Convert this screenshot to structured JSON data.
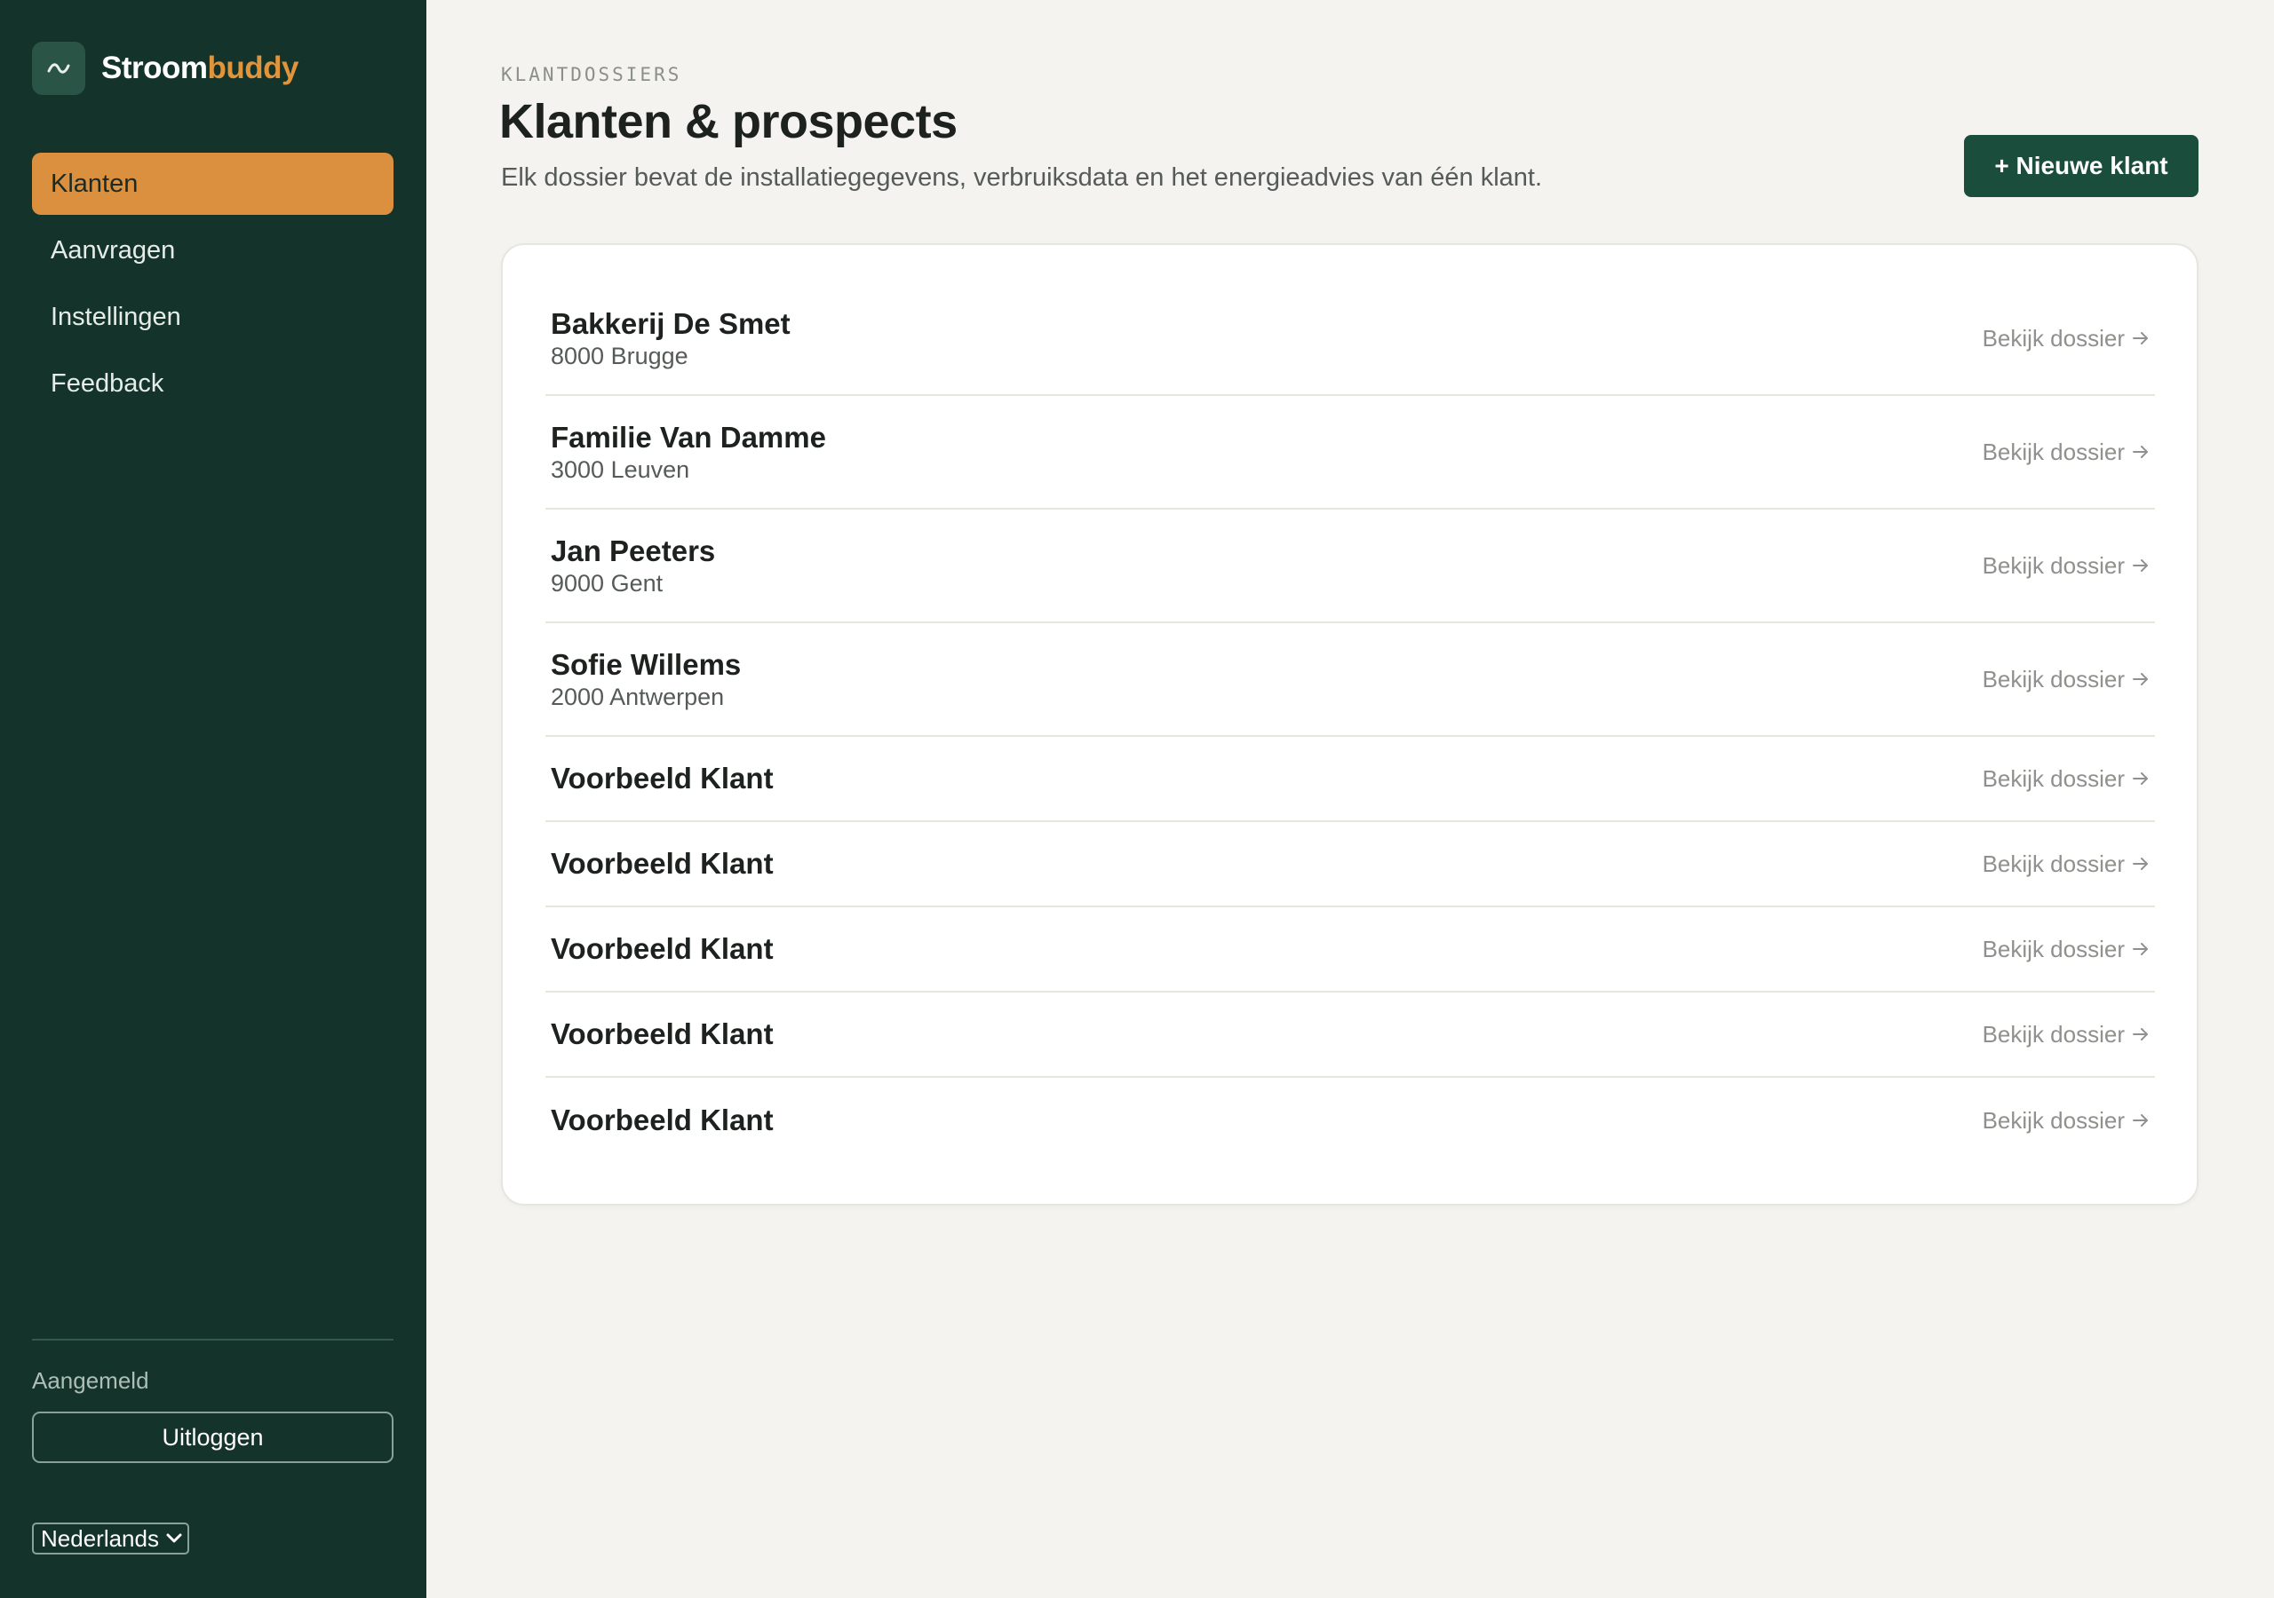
{
  "brand": {
    "name_part1": "Stroom",
    "name_part2": "buddy",
    "logo_icon": "wave-icon",
    "accent_color": "#e0953c"
  },
  "sidebar": {
    "items": [
      {
        "label": "Klanten",
        "active": true
      },
      {
        "label": "Aanvragen",
        "active": false
      },
      {
        "label": "Instellingen",
        "active": false
      },
      {
        "label": "Feedback",
        "active": false
      }
    ],
    "signed_in_label": "Aangemeld",
    "logout_label": "Uitloggen",
    "language": "Nederlands"
  },
  "header": {
    "eyebrow": "KLANTDOSSIERS",
    "title": "Klanten & prospects",
    "subtitle": "Elk dossier bevat de installatiegegevens, verbruiksdata en het energieadvies van één klant.",
    "new_client_label": "+ Nieuwe klant"
  },
  "clients": {
    "link_label": "Bekijk dossier",
    "rows": [
      {
        "name": "Bakkerij De Smet",
        "city": "8000 Brugge"
      },
      {
        "name": "Familie Van Damme",
        "city": "3000 Leuven"
      },
      {
        "name": "Jan Peeters",
        "city": "9000 Gent"
      },
      {
        "name": "Sofie Willems",
        "city": "2000 Antwerpen"
      },
      {
        "name": "Voorbeeld Klant",
        "city": ""
      },
      {
        "name": "Voorbeeld Klant",
        "city": ""
      },
      {
        "name": "Voorbeeld Klant",
        "city": ""
      },
      {
        "name": "Voorbeeld Klant",
        "city": ""
      },
      {
        "name": "Voorbeeld Klant",
        "city": ""
      }
    ]
  },
  "colors": {
    "sidebar_bg": "#14342b",
    "active_nav": "#da903e",
    "primary_button": "#1b4d3d",
    "page_bg": "#f4f3ef"
  }
}
